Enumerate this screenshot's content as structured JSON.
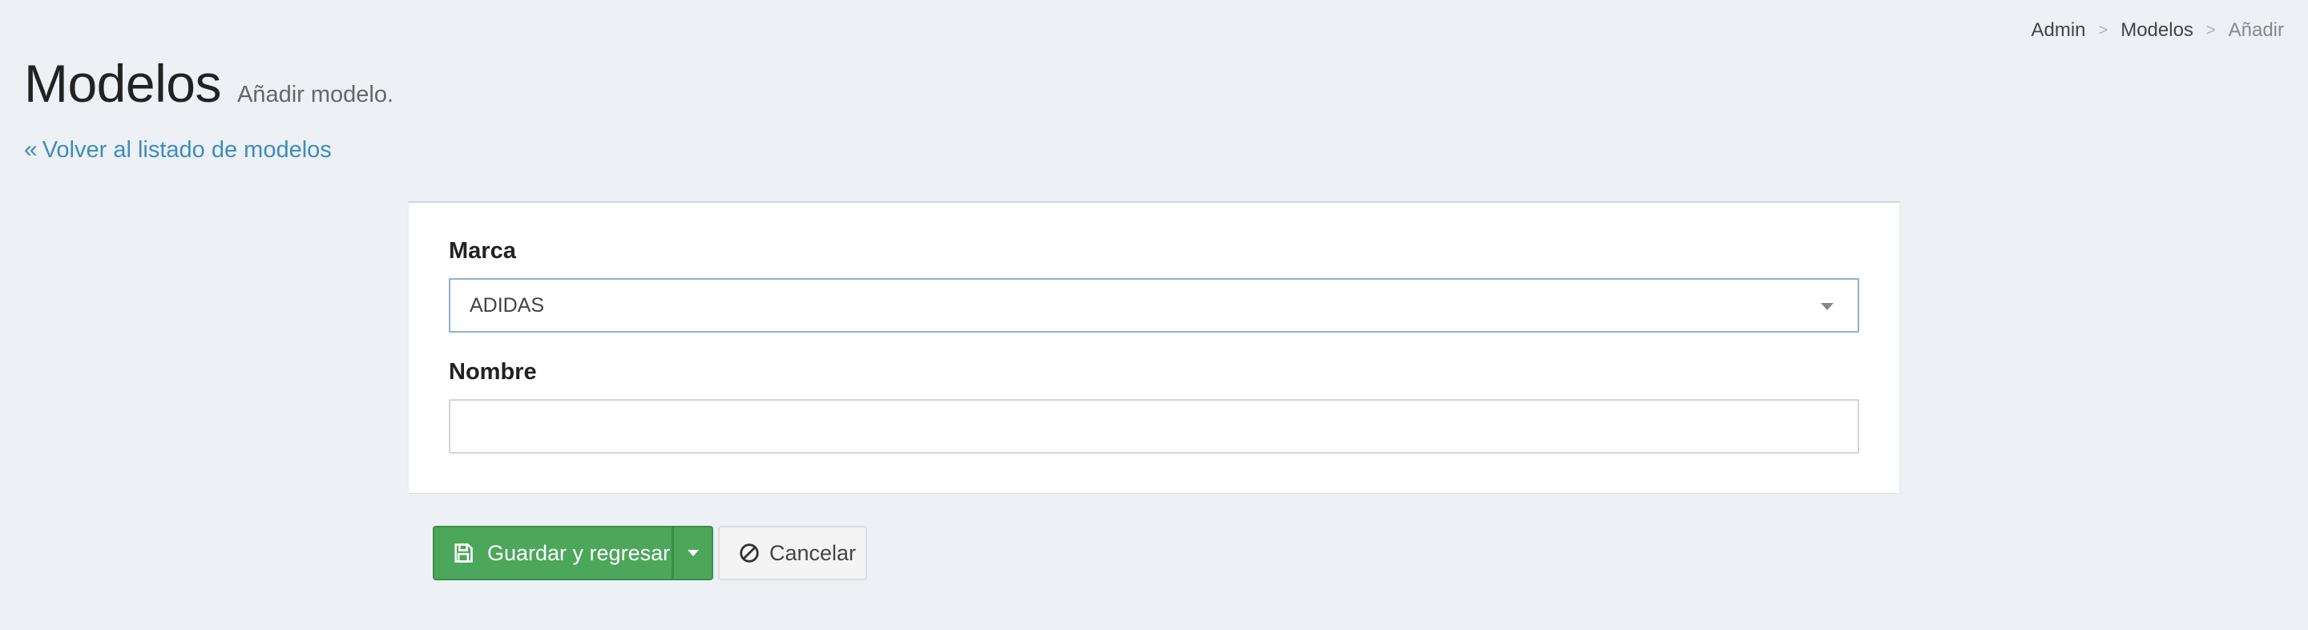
{
  "breadcrumb": {
    "items": [
      "Admin",
      "Modelos",
      "Añadir"
    ],
    "separator": ">"
  },
  "header": {
    "title": "Modelos",
    "subtitle": "Añadir modelo."
  },
  "back_link": {
    "icon": "angle-double-left-icon",
    "label": "Volver al listado de modelos"
  },
  "form": {
    "marca": {
      "label": "Marca",
      "selected": "ADIDAS"
    },
    "nombre": {
      "label": "Nombre",
      "value": "",
      "placeholder": ""
    }
  },
  "actions": {
    "save_label": "Guardar y regresar",
    "save_icon": "floppy-disk-icon",
    "cancel_label": "Cancelar",
    "cancel_icon": "ban-icon"
  },
  "colors": {
    "background": "#edf0f5",
    "link": "#3c8dbc",
    "success": "#4ca65b",
    "select_focus_border": "#8fb0d9"
  }
}
